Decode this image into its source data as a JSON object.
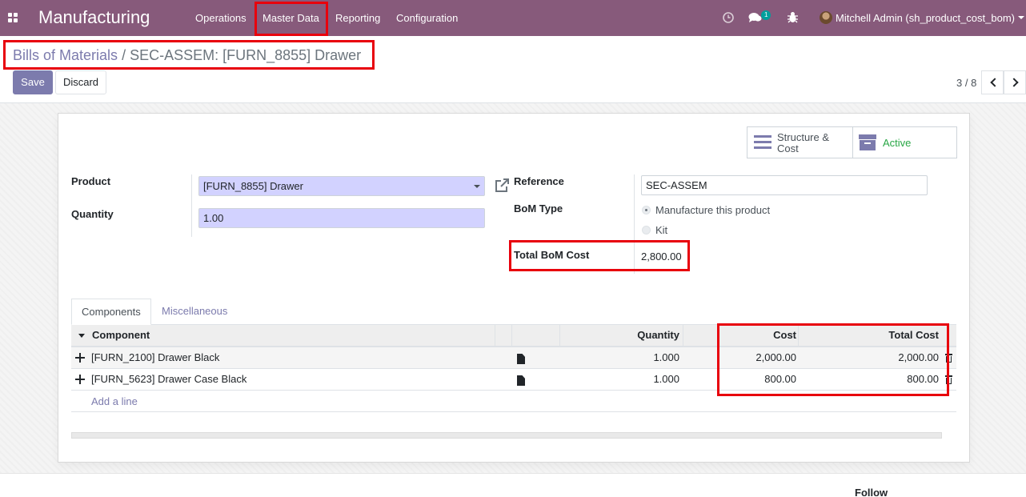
{
  "navbar": {
    "apps_icon": "apps-grid-icon",
    "app_name": "Manufacturing",
    "menus": [
      "Operations",
      "Master Data",
      "Reporting",
      "Configuration"
    ],
    "activity_icon": "clock-icon",
    "chat_icon": "chat-bubbles-icon",
    "chat_badge": "1",
    "debug_icon": "bug-icon",
    "user": "Mitchell Admin (sh_product_cost_bom)"
  },
  "breadcrumb": {
    "parent": "Bills of Materials",
    "separator": "/",
    "current": "SEC-ASSEM: [FURN_8855] Drawer"
  },
  "actions": {
    "save": "Save",
    "discard": "Discard"
  },
  "pager": {
    "value": "3 / 8"
  },
  "button_box": {
    "structure": {
      "icon": "list-icon",
      "label": "Structure & Cost"
    },
    "active": {
      "icon": "archive-icon",
      "label": "Active"
    }
  },
  "form": {
    "product_label": "Product",
    "product_value": "[FURN_8855] Drawer",
    "quantity_label": "Quantity",
    "quantity_value": "1.00",
    "reference_label": "Reference",
    "reference_value": "SEC-ASSEM",
    "bom_type_label": "BoM Type",
    "bom_type_options": [
      "Manufacture this product",
      "Kit"
    ],
    "bom_type_selected": "Manufacture this product",
    "total_cost_label": "Total BoM Cost",
    "total_cost_value": "2,800.00"
  },
  "tabs": [
    "Components",
    "Miscellaneous"
  ],
  "table": {
    "columns": {
      "component": "Component",
      "quantity": "Quantity",
      "cost": "Cost",
      "total_cost": "Total Cost"
    },
    "rows": [
      {
        "component": "[FURN_2100] Drawer Black",
        "quantity": "1.000",
        "cost": "2,000.00",
        "total_cost": "2,000.00"
      },
      {
        "component": "[FURN_5623] Drawer Case Black",
        "quantity": "1.000",
        "cost": "800.00",
        "total_cost": "800.00"
      }
    ],
    "add_line": "Add a line"
  },
  "chatter": {
    "follow": "Follow"
  },
  "colors": {
    "navbar": "#875a7b",
    "primary": "#7c7bad",
    "required_field": "#d2d2ff",
    "annotation": "#e8000c",
    "active_status": "#28a745"
  }
}
